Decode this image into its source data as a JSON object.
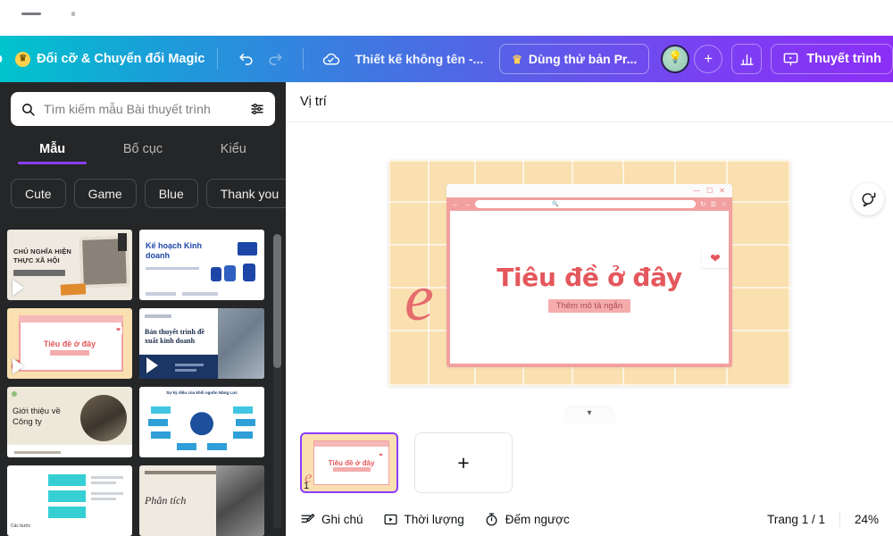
{
  "browser": {
    "chrome_hint": ""
  },
  "topbar": {
    "left_label": "p",
    "magic_button": "Đổi cỡ & Chuyển đổi Magic",
    "undo_icon": "undo-icon",
    "redo_icon": "redo-icon",
    "cloud_icon": "cloud-saved-icon",
    "doc_title": "Thiết kế không tên -...",
    "pro_button": "Dùng thử bản Pr...",
    "avatar_icon": "user-avatar",
    "add_member_label": "+",
    "insights_icon": "bar-chart-icon",
    "present_icon": "present-screen-icon",
    "present_button": "Thuyết trình"
  },
  "sidebar": {
    "search": {
      "placeholder": "Tìm kiếm mẫu Bài thuyết trình",
      "value": "",
      "search_icon": "search-icon",
      "filter_icon": "filter-sliders-icon"
    },
    "tabs": [
      {
        "label": "Mẫu",
        "active": true
      },
      {
        "label": "Bố cục",
        "active": false
      },
      {
        "label": "Kiểu",
        "active": false
      }
    ],
    "chips": [
      "Cute",
      "Game",
      "Blue",
      "Thank you"
    ],
    "chip_next_icon": "chevron-right-icon",
    "templates": [
      {
        "title": "CHỦ NGHĨA HIỆN THỰC XÃ HỘI",
        "style": "collage-beige",
        "has_play": true
      },
      {
        "title": "Kế hoạch Kinh doanh",
        "style": "blue-illustration",
        "has_play": false
      },
      {
        "title": "Tiêu đề ở đây",
        "style": "pink-browser",
        "has_play": true
      },
      {
        "title": "Bản thuyết trình đề xuất kinh doanh",
        "style": "navy-architecture",
        "has_play": true
      },
      {
        "title": "Giới thiệu về Công ty",
        "style": "beige-photo",
        "has_play": false
      },
      {
        "title": "Sự kỳ diệu của khối nguồn Năng Lực",
        "style": "mindmap-blue",
        "has_play": false
      },
      {
        "title": "Các bước",
        "style": "teal-arrows",
        "has_play": false
      },
      {
        "title": "Phân tích",
        "style": "mono-photo",
        "has_play": false
      }
    ],
    "collapse_icon": "chevron-left-icon"
  },
  "editor": {
    "position_label": "Vị trí",
    "comment_icon": "add-comment-icon",
    "canvas_tab_icon": "chevron-down-icon",
    "slide": {
      "title": "Tiêu đề ở đây",
      "subtitle": "Thêm mô tả ngắn",
      "heart_icon": "heart-icon",
      "window": {
        "minimize_icon": "minimize-icon",
        "maximize_icon": "maximize-icon",
        "close_icon": "close-icon",
        "back_icon": "arrow-left-icon",
        "forward_icon": "arrow-right-icon",
        "url_search_icon": "search-icon",
        "reload_icon": "reload-icon",
        "menu_icon": "hamburger-menu-icon",
        "bookmark_icon": "star-icon",
        "url_value": ""
      },
      "background_color": "#fae0b0",
      "accent_color": "#e4575c"
    }
  },
  "filmstrip": {
    "slides": [
      {
        "number": "1",
        "title": "Tiêu đề ở đây",
        "selected": true
      }
    ],
    "add_slide_label": "+"
  },
  "bottombar": {
    "notes": {
      "label": "Ghi chú",
      "icon": "notes-icon"
    },
    "duration": {
      "label": "Thời lượng",
      "icon": "play-box-icon"
    },
    "countdown": {
      "label": "Đếm ngược",
      "icon": "stopwatch-icon"
    },
    "page_indicator": "Trang 1 / 1",
    "zoom_level": "24%"
  },
  "colors": {
    "gradient_start": "#00c4cc",
    "gradient_mid": "#5a5ee8",
    "gradient_end": "#8b2ff7",
    "panel_bg": "#252627",
    "accent_purple": "#8b3dff",
    "slide_pink": "#e4575c",
    "slide_bg": "#fae0b0"
  }
}
